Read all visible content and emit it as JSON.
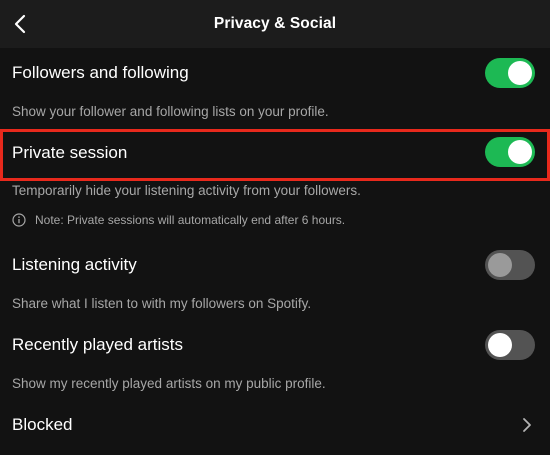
{
  "header": {
    "title": "Privacy & Social",
    "back_icon": "chevron-left-icon"
  },
  "settings": [
    {
      "label": "Followers and following",
      "description": "Show your follower and following lists on your profile.",
      "toggle": "on"
    },
    {
      "label": "Private session",
      "description": "Temporarily hide your listening activity from your followers.",
      "note": "Note: Private sessions will automatically end after 6 hours.",
      "note_icon": "info-icon",
      "toggle": "on",
      "highlighted": true
    },
    {
      "label": "Listening activity",
      "description": "Share what I listen to with my followers on Spotify.",
      "toggle": "off"
    },
    {
      "label": "Recently played artists",
      "description": "Show my recently played artists on my public profile.",
      "toggle": "off"
    }
  ],
  "blocked": {
    "label": "Blocked",
    "icon": "chevron-right-icon"
  },
  "colors": {
    "background": "#121212",
    "header": "#1c1c1c",
    "toggle_on": "#1db954",
    "toggle_off": "#535353",
    "secondary_text": "#a7a7a7",
    "highlight_border": "#e8291c"
  }
}
